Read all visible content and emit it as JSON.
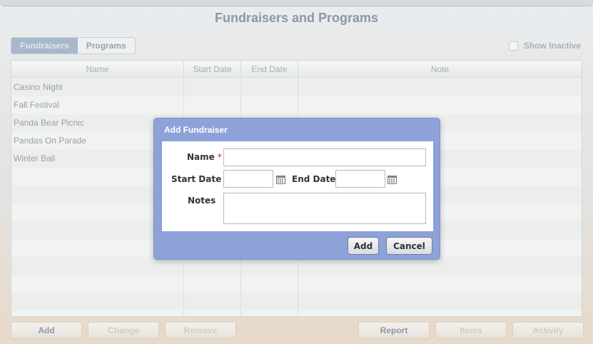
{
  "page": {
    "title": "Fundraisers and Programs"
  },
  "tabs": [
    {
      "label": "Fundraisers",
      "active": true
    },
    {
      "label": "Programs",
      "active": false
    }
  ],
  "show_inactive": {
    "label": "Show Inactive",
    "checked": false
  },
  "table": {
    "columns": [
      "Name",
      "Start Date",
      "End Date",
      "Note"
    ],
    "rows": [
      {
        "name": "Casino Night",
        "start": "",
        "end": "",
        "note": ""
      },
      {
        "name": "Fall Festival",
        "start": "",
        "end": "",
        "note": ""
      },
      {
        "name": "Panda Bear Picnic",
        "start": "",
        "end": "",
        "note": ""
      },
      {
        "name": "Pandas On Parade",
        "start": "",
        "end": "",
        "note": ""
      },
      {
        "name": "Winter Ball",
        "start": "",
        "end": "",
        "note": ""
      }
    ]
  },
  "buttons": {
    "add": "Add",
    "change": "Change",
    "remove": "Remove",
    "report": "Report",
    "items": "Items",
    "activity": "Activity"
  },
  "dialog": {
    "title": "Add Fundraiser",
    "name_label": "Name",
    "required_mark": "*",
    "start_date_label": "Start Date",
    "end_date_label": "End Date",
    "notes_label": "Notes",
    "name_value": "",
    "start_date_value": "",
    "end_date_value": "",
    "notes_value": "",
    "add_label": "Add",
    "cancel_label": "Cancel"
  },
  "colors": {
    "dialog_frame": "#8da2d8",
    "active_tab": "#a7b8cc",
    "required": "#cc2222"
  }
}
